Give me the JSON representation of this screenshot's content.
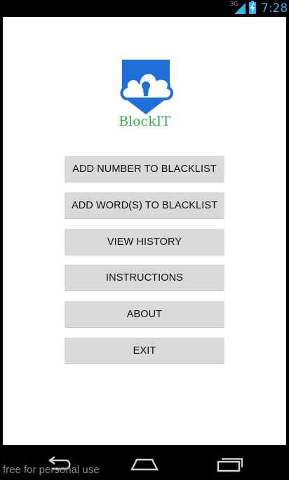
{
  "status_bar": {
    "network_type": "3G",
    "time": "7:28",
    "accent_color": "#33b5e5"
  },
  "app": {
    "title": "BlockIT",
    "title_color": "#2bb24c",
    "logo_icon": "cloud-lock-icon",
    "logo_color": "#1e6fd9"
  },
  "menu": {
    "add_number": "ADD NUMBER TO BLACKLIST",
    "add_words": "ADD WORD(S) TO BLACKLIST",
    "view_history": "VIEW HISTORY",
    "instructions": "INSTRUCTIONS",
    "about": "ABOUT",
    "exit": "EXIT"
  },
  "nav_bar": {
    "back_icon": "back-icon",
    "home_icon": "home-icon",
    "recents_icon": "recent-apps-icon"
  },
  "watermark": "free for personal use"
}
